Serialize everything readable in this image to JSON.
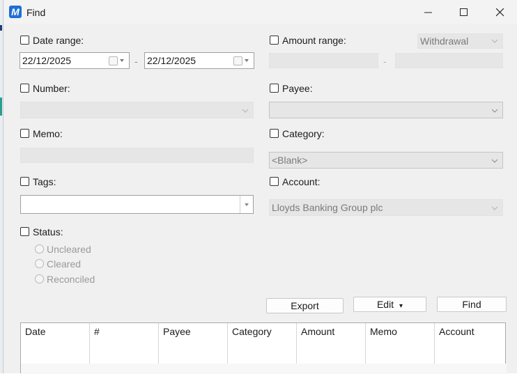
{
  "window": {
    "title": "Find",
    "app_icon_letter": "M"
  },
  "date_range": {
    "label": "Date range:",
    "from": "22/12/2025",
    "to": "22/12/2025",
    "separator": "-"
  },
  "amount_range": {
    "label": "Amount range:",
    "type_value": "Withdrawal",
    "separator": "-"
  },
  "number": {
    "label": "Number:"
  },
  "payee": {
    "label": "Payee:"
  },
  "memo": {
    "label": "Memo:"
  },
  "category": {
    "label": "Category:",
    "value": "<Blank>"
  },
  "tags": {
    "label": "Tags:"
  },
  "account": {
    "label": "Account:",
    "value": "Lloyds Banking Group plc"
  },
  "status": {
    "label": "Status:",
    "options": [
      "Uncleared",
      "Cleared",
      "Reconciled"
    ]
  },
  "buttons": {
    "export": "Export",
    "edit": "Edit",
    "edit_arrow": "▾",
    "find": "Find"
  },
  "results": {
    "columns": [
      "Date",
      "#",
      "Payee",
      "Category",
      "Amount",
      "Memo",
      "Account"
    ]
  },
  "colors": {
    "accent": "#1f6fd6",
    "window_bg": "#f0f0f0"
  }
}
